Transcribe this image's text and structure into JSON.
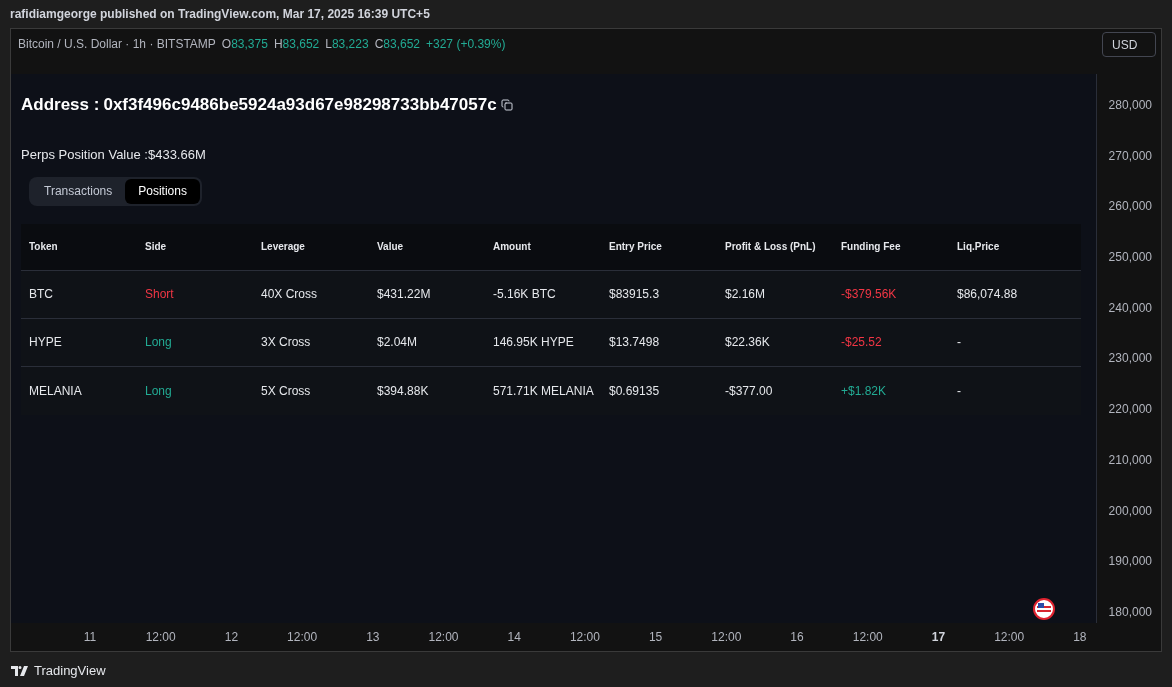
{
  "header": {
    "text": "rafidiamgeorge published on TradingView.com, Mar 17, 2025 16:39 UTC+5"
  },
  "legend": {
    "symbol": "Bitcoin / U.S. Dollar · 1h · BITSTAMP",
    "ohlc": [
      {
        "label": "O",
        "value": "83,375"
      },
      {
        "label": "H",
        "value": "83,652"
      },
      {
        "label": "L",
        "value": "83,223"
      },
      {
        "label": "C",
        "value": "83,652"
      }
    ],
    "change": "+327 (+0.39%)"
  },
  "currency_button": "USD",
  "address": {
    "label": "Address :",
    "value": "0xf3f496c9486be5924a93d67e98298733bb47057c"
  },
  "position_value": "Perps Position Value :$433.66M",
  "tabs": [
    {
      "label": "Transactions",
      "selected": false
    },
    {
      "label": "Positions",
      "selected": true
    }
  ],
  "table": {
    "columns": [
      "Token",
      "Side",
      "Leverage",
      "Value",
      "Amount",
      "Entry Price",
      "Profit & Loss (PnL)",
      "Funding Fee",
      "Liq.Price"
    ],
    "rows": [
      [
        {
          "text": "BTC",
          "color": "#e6e8ec"
        },
        {
          "text": "Short",
          "color": "#f23645"
        },
        {
          "text": "40X Cross",
          "color": "#e6e8ec"
        },
        {
          "text": "$431.22M",
          "color": "#e6e8ec"
        },
        {
          "text": "-5.16K BTC",
          "color": "#e6e8ec"
        },
        {
          "text": "$83915.3",
          "color": "#e6e8ec"
        },
        {
          "text": "$2.16M",
          "color": "#e6e8ec"
        },
        {
          "text": "-$379.56K",
          "color": "#f23645"
        },
        {
          "text": "$86,074.88",
          "color": "#e6e8ec"
        }
      ],
      [
        {
          "text": "HYPE",
          "color": "#e6e8ec"
        },
        {
          "text": "Long",
          "color": "#22ab94"
        },
        {
          "text": "3X Cross",
          "color": "#e6e8ec"
        },
        {
          "text": "$2.04M",
          "color": "#e6e8ec"
        },
        {
          "text": "146.95K HYPE",
          "color": "#e6e8ec"
        },
        {
          "text": "$13.7498",
          "color": "#e6e8ec"
        },
        {
          "text": "$22.36K",
          "color": "#e6e8ec"
        },
        {
          "text": "-$25.52",
          "color": "#f23645"
        },
        {
          "text": "-"
        }
      ],
      [
        {
          "text": "MELANIA",
          "color": "#e6e8ec"
        },
        {
          "text": "Long",
          "color": "#22ab94"
        },
        {
          "text": "5X Cross",
          "color": "#e6e8ec"
        },
        {
          "text": "$394.88K",
          "color": "#e6e8ec"
        },
        {
          "text": "571.71K MELANIA",
          "color": "#e6e8ec"
        },
        {
          "text": "$0.69135",
          "color": "#e6e8ec"
        },
        {
          "text": "-$377.00",
          "color": "#e6e8ec"
        },
        {
          "text": "+$1.82K",
          "color": "#22ab94"
        },
        {
          "text": "-"
        }
      ]
    ]
  },
  "price_axis": [
    "280,000",
    "270,000",
    "260,000",
    "250,000",
    "240,000",
    "230,000",
    "220,000",
    "210,000",
    "200,000",
    "190,000",
    "180,000"
  ],
  "time_axis": [
    {
      "label": "11",
      "bold": false
    },
    {
      "label": "12:00",
      "bold": false
    },
    {
      "label": "12",
      "bold": false
    },
    {
      "label": "12:00",
      "bold": false
    },
    {
      "label": "13",
      "bold": false
    },
    {
      "label": "12:00",
      "bold": false
    },
    {
      "label": "14",
      "bold": false
    },
    {
      "label": "12:00",
      "bold": false
    },
    {
      "label": "15",
      "bold": false
    },
    {
      "label": "12:00",
      "bold": false
    },
    {
      "label": "16",
      "bold": false
    },
    {
      "label": "12:00",
      "bold": false
    },
    {
      "label": "17",
      "bold": true
    },
    {
      "label": "12:00",
      "bold": false
    },
    {
      "label": "18",
      "bold": false
    }
  ],
  "footer": {
    "brand": "TradingView"
  }
}
